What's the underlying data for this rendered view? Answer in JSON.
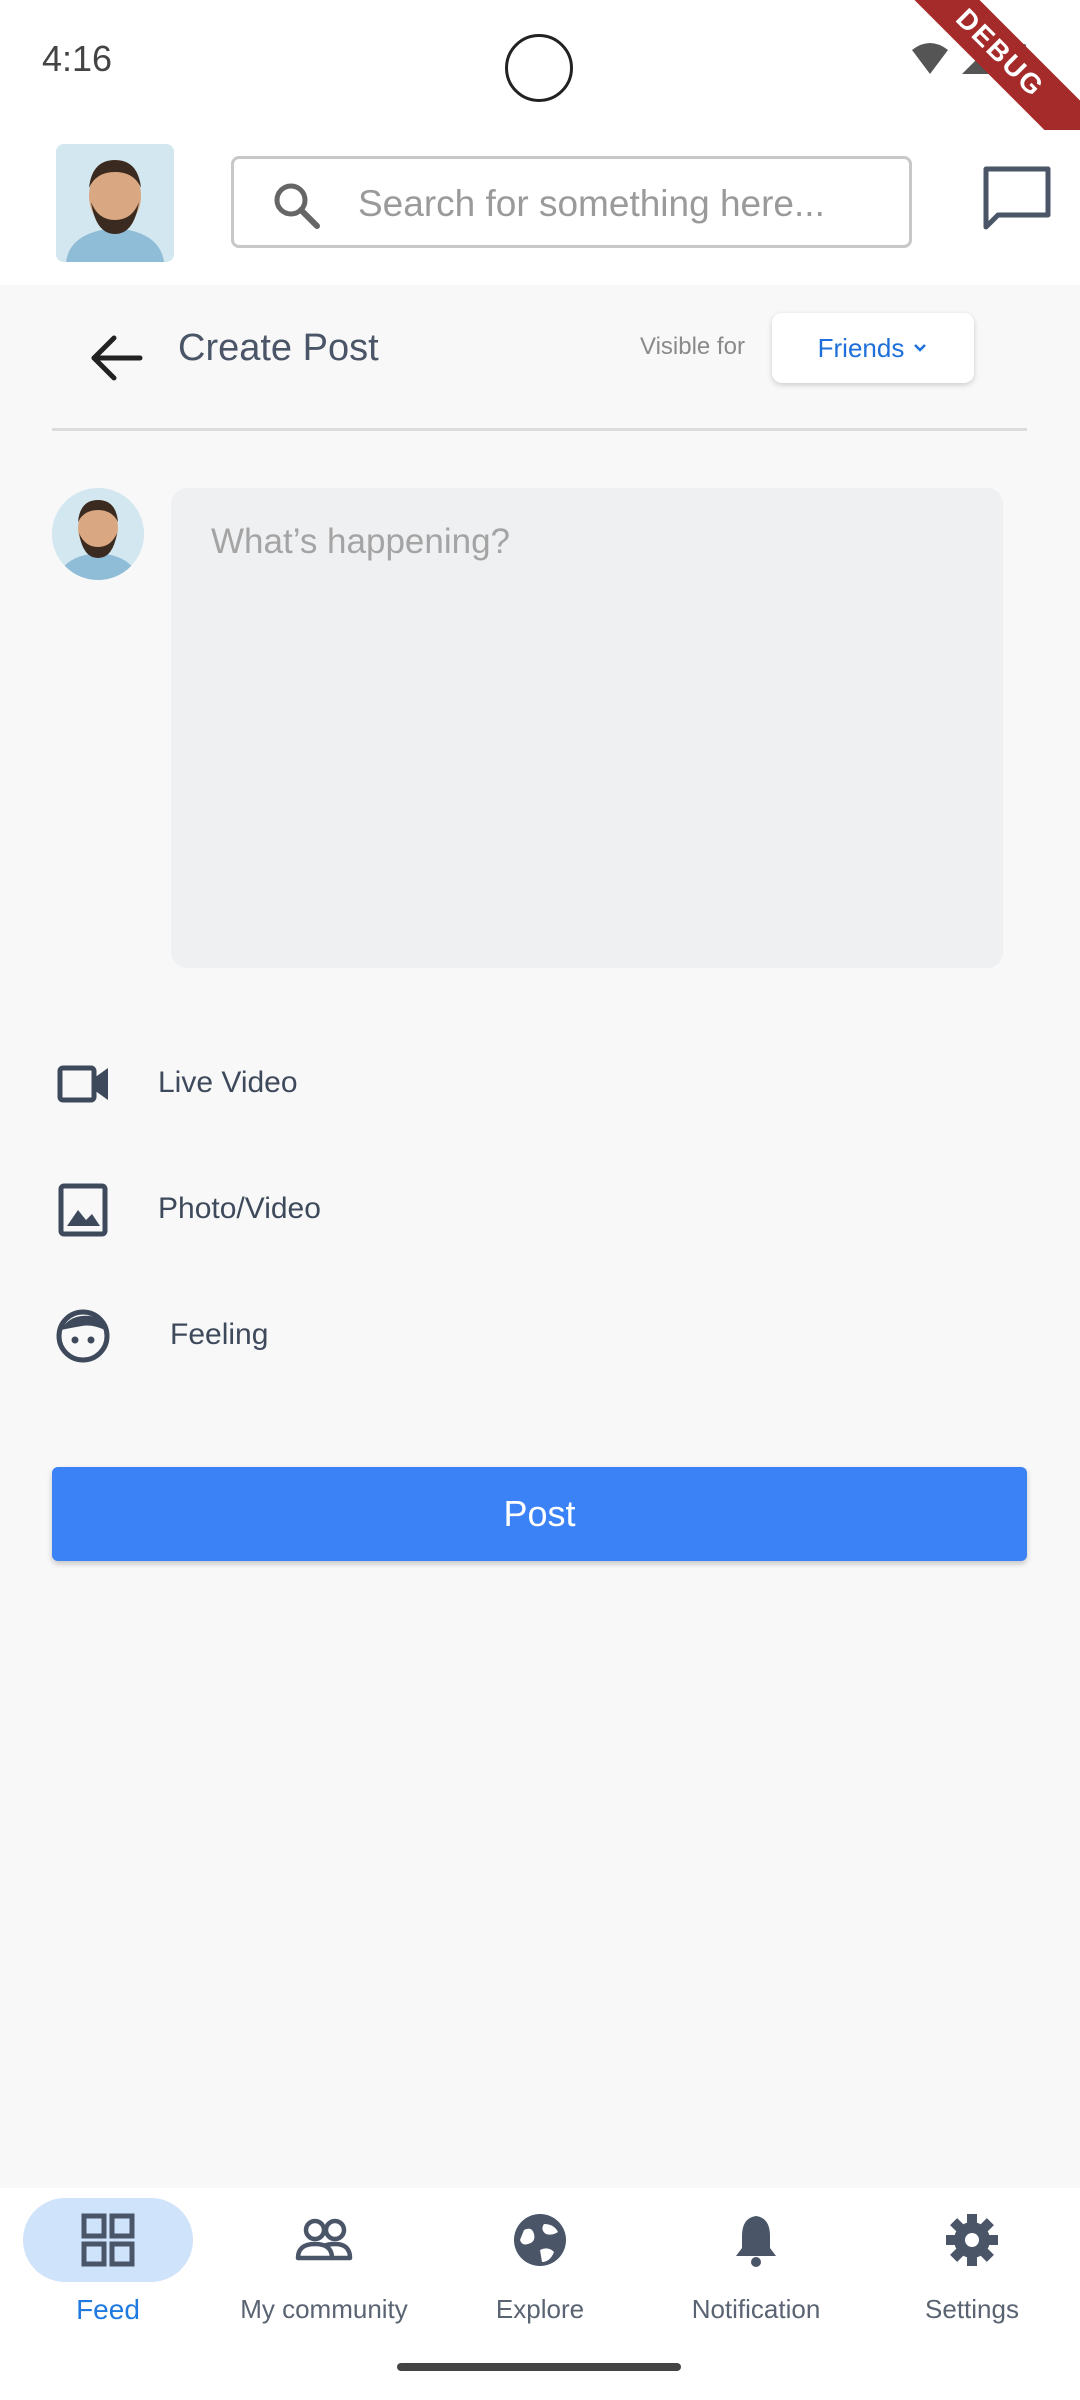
{
  "status_bar": {
    "time": "4:16",
    "debug_label": "DEBUG"
  },
  "top_bar": {
    "search_placeholder": "Search for something here..."
  },
  "header": {
    "title": "Create Post",
    "visible_label": "Visible for",
    "visibility_value": "Friends"
  },
  "composer": {
    "placeholder": "What’s happening?"
  },
  "options": [
    {
      "label": "Live Video",
      "icon": "video-camera-icon"
    },
    {
      "label": "Photo/Video",
      "icon": "image-icon"
    },
    {
      "label": "Feeling",
      "icon": "smiley-icon"
    }
  ],
  "post_button": {
    "label": "Post"
  },
  "nav": [
    {
      "label": "Feed",
      "icon": "grid-icon",
      "active": true
    },
    {
      "label": "My community",
      "icon": "people-icon",
      "active": false
    },
    {
      "label": "Explore",
      "icon": "globe-icon",
      "active": false
    },
    {
      "label": "Notification",
      "icon": "bell-icon",
      "active": false
    },
    {
      "label": "Settings",
      "icon": "gear-icon",
      "active": false
    }
  ],
  "colors": {
    "accent": "#3b82f6",
    "nav_active": "#1e7ae0",
    "nav_pill": "#cfe3fb"
  }
}
